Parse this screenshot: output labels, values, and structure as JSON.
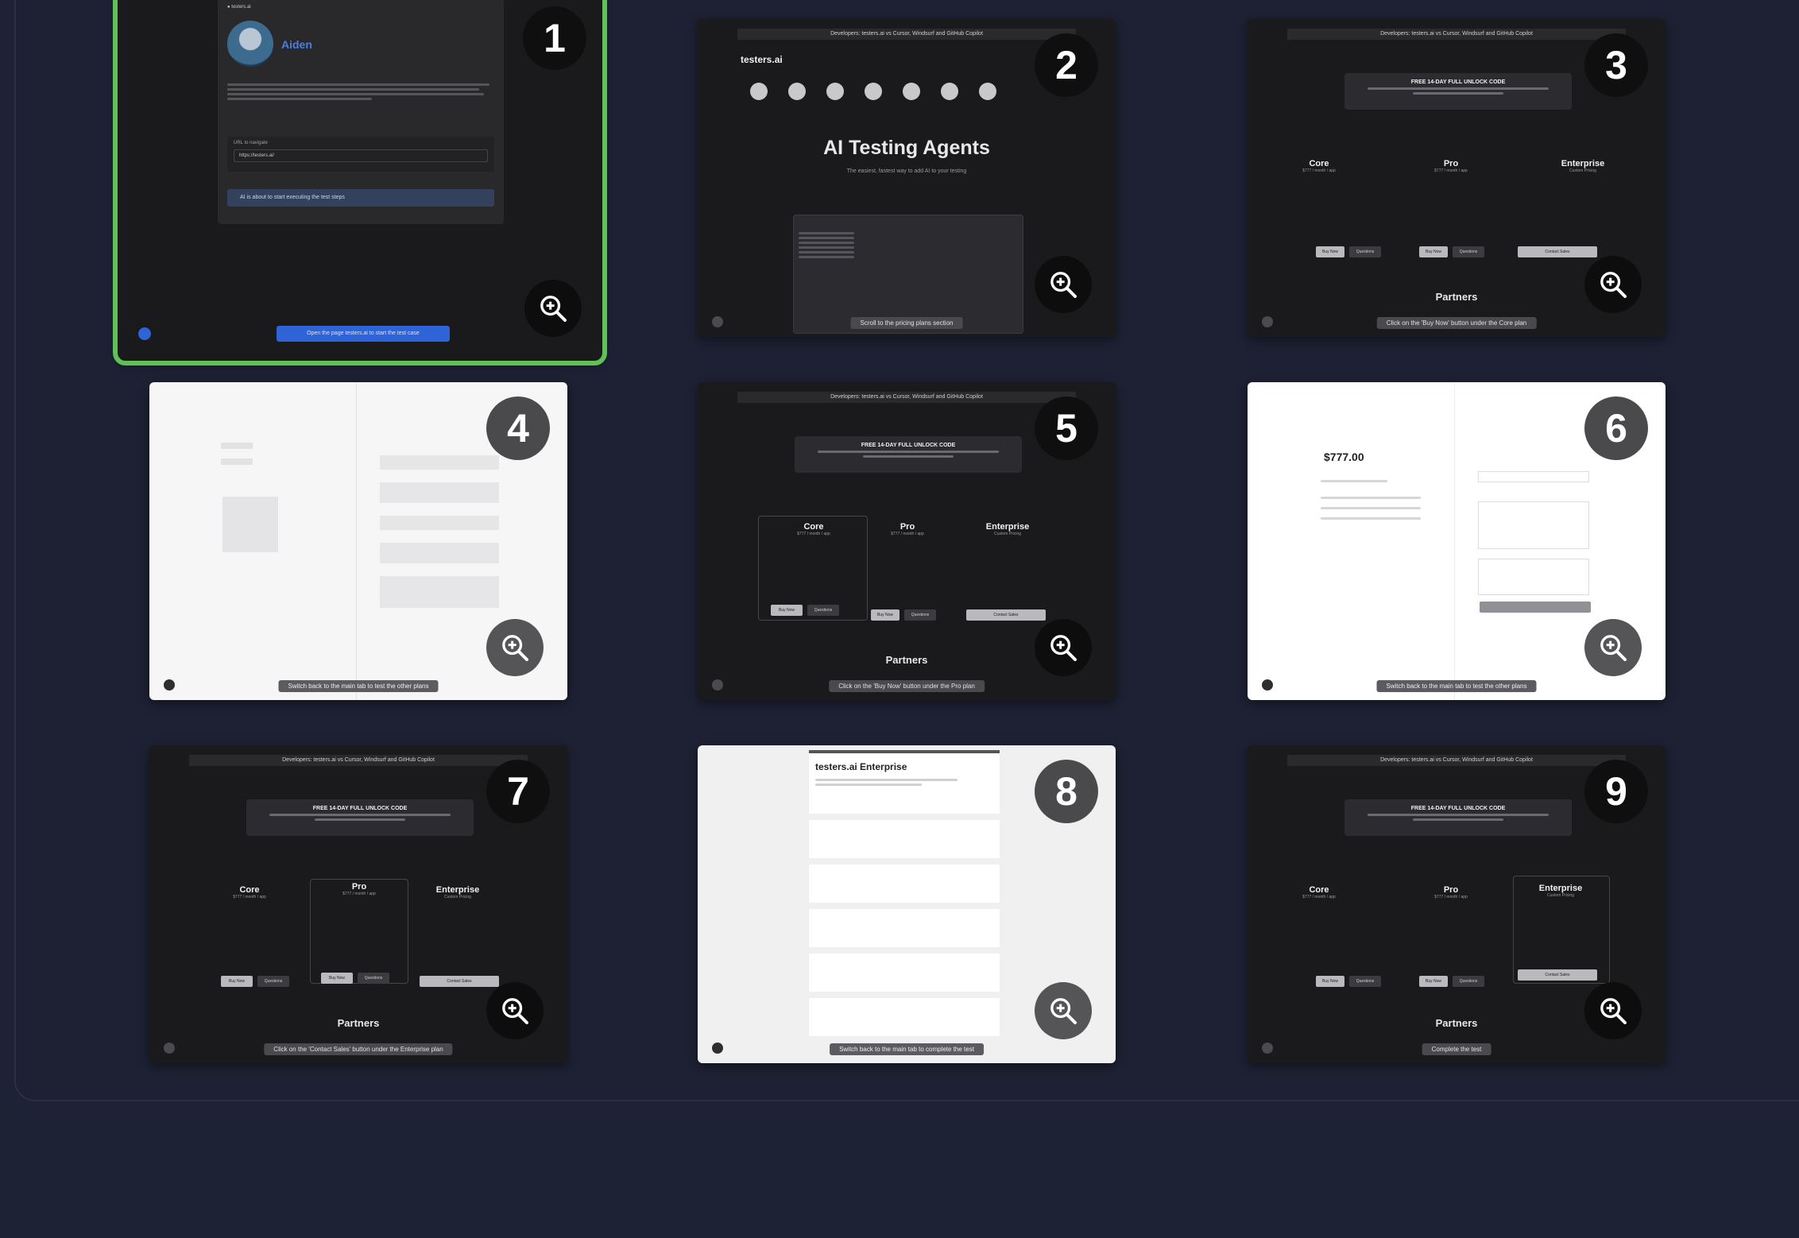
{
  "cards": [
    {
      "num": "1",
      "caption": "Open the page testers.ai to start the test case",
      "user": "Aiden",
      "url_label": "URL to navigate",
      "url_value": "https://testers.ai/",
      "status": "AI is about to start executing the test steps"
    },
    {
      "num": "2",
      "caption": "Scroll to the pricing plans section",
      "brand": "testers.ai",
      "heading": "AI Testing Agents",
      "tagline": "The easiest, fastest way to add AI to your testing",
      "topbar": "Developers: testers.ai vs Cursor, Windsurf and GitHub Copilot"
    },
    {
      "num": "3",
      "caption": "Click on the 'Buy Now' button under the Core plan",
      "topbar": "Developers: testers.ai vs Cursor, Windsurf and GitHub Copilot",
      "promo": "FREE 14-DAY FULL UNLOCK CODE",
      "tiers": [
        "Core",
        "Pro",
        "Enterprise"
      ],
      "partners": "Partners"
    },
    {
      "num": "4",
      "caption": "Switch back to the main tab to test the other plans"
    },
    {
      "num": "5",
      "caption": "Click on the 'Buy Now' button under the Pro plan",
      "topbar": "Developers: testers.ai vs Cursor, Windsurf and GitHub Copilot",
      "promo": "FREE 14-DAY FULL UNLOCK CODE",
      "tiers": [
        "Core",
        "Pro",
        "Enterprise"
      ],
      "partners": "Partners"
    },
    {
      "num": "6",
      "caption": "Switch back to the main tab to test the other plans",
      "price": "$777.00"
    },
    {
      "num": "7",
      "caption": "Click on the 'Contact Sales' button under the Enterprise plan",
      "topbar": "Developers: testers.ai vs Cursor, Windsurf and GitHub Copilot",
      "promo": "FREE 14-DAY FULL UNLOCK CODE",
      "tiers": [
        "Core",
        "Pro",
        "Enterprise"
      ],
      "partners": "Partners"
    },
    {
      "num": "8",
      "caption": "Switch back to the main tab to complete the test",
      "form_title": "testers.ai Enterprise"
    },
    {
      "num": "9",
      "caption": "Complete the test",
      "topbar": "Developers: testers.ai vs Cursor, Windsurf and GitHub Copilot",
      "promo": "FREE 14-DAY FULL UNLOCK CODE",
      "tiers": [
        "Core",
        "Pro",
        "Enterprise"
      ],
      "partners": "Partners"
    }
  ],
  "colors": {
    "background": "#1e2235",
    "selected_outline": "#5fc158",
    "accent_blue": "#2f63d8"
  }
}
